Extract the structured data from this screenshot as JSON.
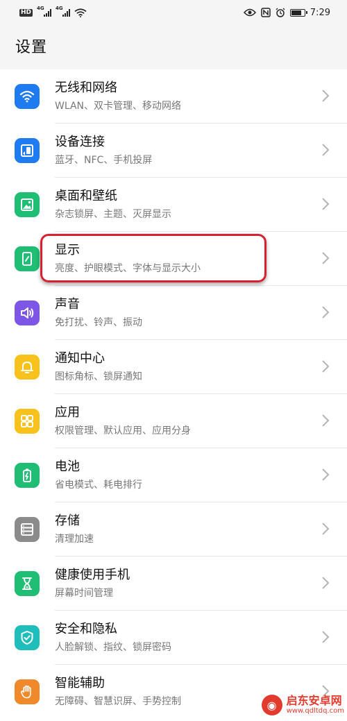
{
  "status_bar": {
    "hd": "HD",
    "net1": "4G",
    "net2": "4G",
    "time": "7:29"
  },
  "page": {
    "title": "设置"
  },
  "colors": {
    "wifi": "#1e7cf0",
    "device": "#1e7cf0",
    "desktop": "#1fbe74",
    "display": "#1fbe74",
    "sound": "#7d56e8",
    "notify": "#f7c21b",
    "apps": "#f7c21b",
    "battery": "#1fbe74",
    "storage": "#8b8b8b",
    "health": "#1fbe74",
    "security": "#1fbebb",
    "assist": "#f0892a",
    "highlight": "#d8212f"
  },
  "settings": [
    {
      "label": "无线和网络",
      "sub": "WLAN、双卡管理、移动网络",
      "icon": "wifi-icon"
    },
    {
      "label": "设备连接",
      "sub": "蓝牙、NFC、手机投屏",
      "icon": "device-connect-icon"
    },
    {
      "label": "桌面和壁纸",
      "sub": "杂志锁屏、主题、灭屏显示",
      "icon": "wallpaper-icon"
    },
    {
      "label": "显示",
      "sub": "亮度、护眼模式、字体与显示大小",
      "icon": "display-icon"
    },
    {
      "label": "声音",
      "sub": "免打扰、铃声、振动",
      "icon": "speaker-icon"
    },
    {
      "label": "通知中心",
      "sub": "图标角标、锁屏通知",
      "icon": "bell-icon"
    },
    {
      "label": "应用",
      "sub": "权限管理、默认应用、应用分身",
      "icon": "apps-grid-icon"
    },
    {
      "label": "电池",
      "sub": "省电模式、耗电排行",
      "icon": "battery-icon"
    },
    {
      "label": "存储",
      "sub": "清理加速",
      "icon": "storage-icon"
    },
    {
      "label": "健康使用手机",
      "sub": "屏幕时间管理",
      "icon": "hourglass-icon"
    },
    {
      "label": "安全和隐私",
      "sub": "人脸解锁、指纹、锁屏密码",
      "icon": "shield-icon"
    },
    {
      "label": "智能辅助",
      "sub": "无障碍、智慧识屏、手势控制",
      "icon": "hand-icon"
    }
  ],
  "watermark": {
    "name": "启东安卓网",
    "url": "www.qdltdq.com"
  }
}
